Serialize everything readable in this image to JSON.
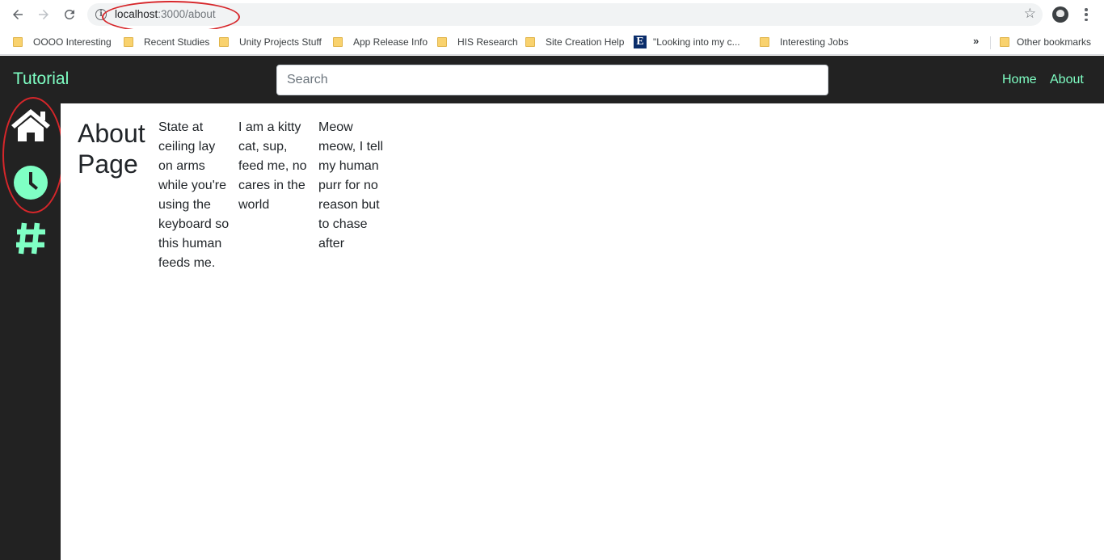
{
  "browser": {
    "url_host": "localhost",
    "url_path": ":3000/about",
    "bookmarks": [
      {
        "label": "OOOO Interesting",
        "icon": "folder-icon"
      },
      {
        "label": "Recent Studies",
        "icon": "folder-icon"
      },
      {
        "label": "Unity Projects Stuff",
        "icon": "folder-icon"
      },
      {
        "label": "App Release Info",
        "icon": "folder-icon"
      },
      {
        "label": "HIS Research",
        "icon": "folder-icon"
      },
      {
        "label": "Site Creation Help",
        "icon": "folder-icon"
      },
      {
        "label": "\"Looking into my c...",
        "icon": "e-site-icon",
        "icon_letter": "E"
      },
      {
        "label": "Interesting Jobs",
        "icon": "folder-icon"
      }
    ],
    "overflow": "»",
    "other_bookmarks": "Other bookmarks"
  },
  "navbar": {
    "brand": "Tutorial",
    "search_placeholder": "Search",
    "links": [
      "Home",
      "About"
    ]
  },
  "sidebar": {
    "icons": [
      "home-icon",
      "clock-icon",
      "hashtag-icon"
    ]
  },
  "main": {
    "title": "About Page",
    "columns": [
      "State at ceiling lay on arms while you're using the keyboard so this human feeds me.",
      "I am a kitty cat, sup, feed me, no cares in the world",
      "Meow meow, I tell my human purr for no reason but to chase after"
    ]
  },
  "colors": {
    "accent": "#7fffc4",
    "dark": "#222222",
    "annotation": "#d6262a"
  }
}
